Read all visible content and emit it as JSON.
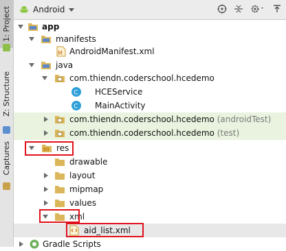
{
  "side_tabs": [
    "1: Project",
    "Z: Structure",
    "Captures"
  ],
  "toolbar": {
    "view_label": "Android"
  },
  "tree": {
    "app": "app",
    "manifests": "manifests",
    "android_manifest": "AndroidManifest.xml",
    "java": "java",
    "pkg_main": "com.thiendn.coderschool.hcedemo",
    "hce_service": "HCEService",
    "main_activity": "MainActivity",
    "pkg_android_test": "com.thiendn.coderschool.hcedemo",
    "pkg_android_test_suffix": "(androidTest)",
    "pkg_test": "com.thiendn.coderschool.hcedemo",
    "pkg_test_suffix": "(test)",
    "res": "res",
    "drawable": "drawable",
    "layout": "layout",
    "mipmap": "mipmap",
    "values": "values",
    "xml": "xml",
    "aid_list": "aid_list.xml",
    "gradle_scripts": "Gradle Scripts"
  },
  "colors": {
    "highlight": "#e0101a",
    "tinted_row": "#e9f3df",
    "folder": "#dcb65a",
    "class_icon": "#2e9fd8"
  }
}
